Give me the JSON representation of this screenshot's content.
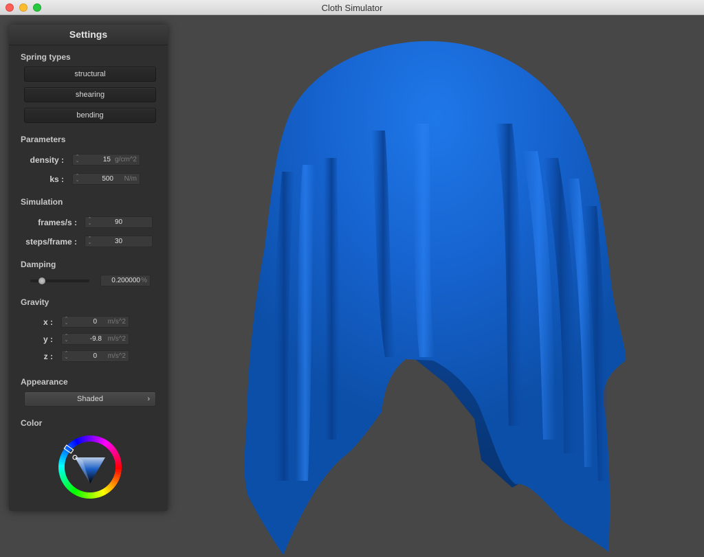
{
  "window": {
    "title": "Cloth Simulator"
  },
  "panel": {
    "title": "Settings",
    "spring_types": {
      "label": "Spring types",
      "buttons": [
        "structural",
        "shearing",
        "bending"
      ]
    },
    "parameters": {
      "label": "Parameters",
      "density": {
        "label": "density :",
        "value": "15",
        "unit": "g/cm^2"
      },
      "ks": {
        "label": "ks :",
        "value": "500",
        "unit": "N/m"
      }
    },
    "simulation": {
      "label": "Simulation",
      "fps": {
        "label": "frames/s :",
        "value": "90"
      },
      "steps": {
        "label": "steps/frame :",
        "value": "30"
      }
    },
    "damping": {
      "label": "Damping",
      "slider_fraction": 0.2,
      "value": "0.200000",
      "unit": "%"
    },
    "gravity": {
      "label": "Gravity",
      "x": {
        "label": "x :",
        "value": "0",
        "unit": "m/s^2"
      },
      "y": {
        "label": "y :",
        "value": "-9.8",
        "unit": "m/s^2"
      },
      "z": {
        "label": "z :",
        "value": "0",
        "unit": "m/s^2"
      }
    },
    "appearance": {
      "label": "Appearance",
      "selected": "Shaded",
      "chevron": "›"
    },
    "color": {
      "label": "Color",
      "selected_hex": "#0f5fc4"
    }
  },
  "scene": {
    "cloth_color": "#1060c8",
    "background": "#474747"
  }
}
